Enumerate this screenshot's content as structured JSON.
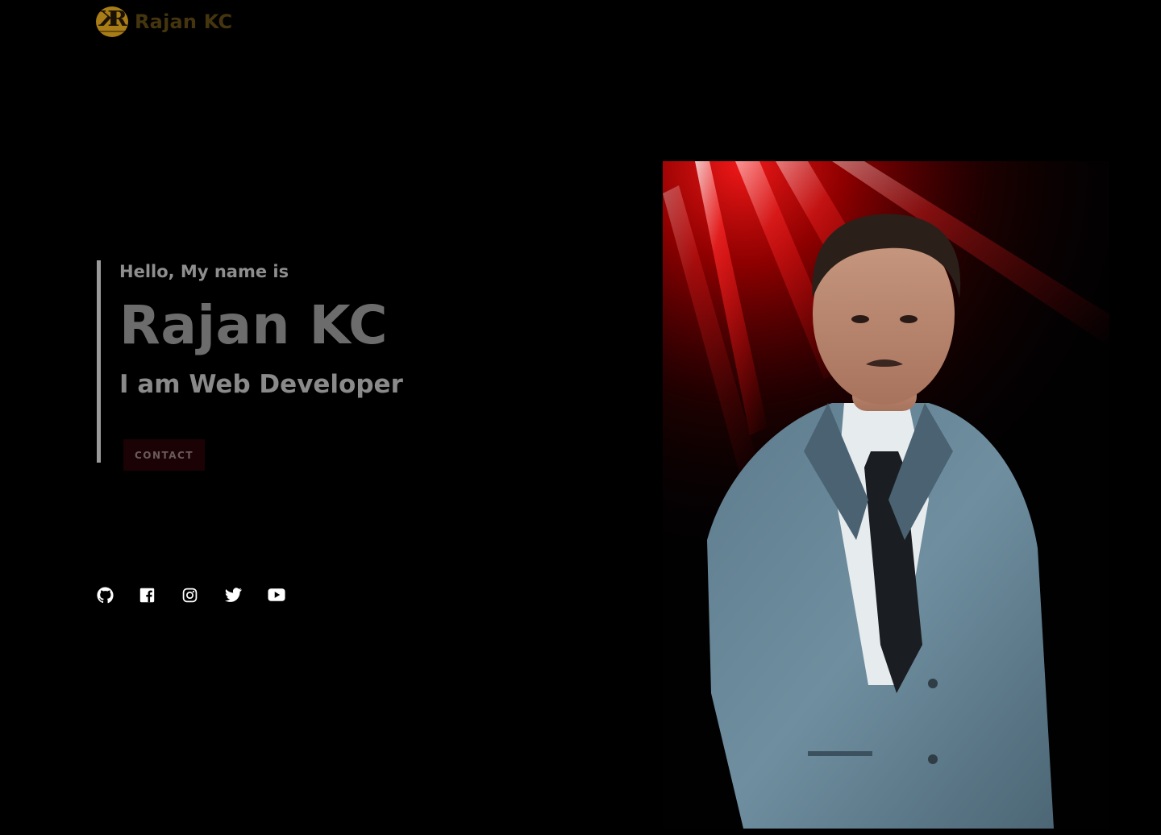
{
  "header": {
    "logo_text": "Rajan KC",
    "logo_mark": "KR monogram",
    "logo_color": "#a87c16"
  },
  "hero": {
    "greeting": "Hello, My name is",
    "name": "Rajan KC",
    "role": "I am Web Developer",
    "cta_label": "CONTACT"
  },
  "socials": [
    {
      "icon": "github-icon",
      "name": "GitHub"
    },
    {
      "icon": "facebook-icon",
      "name": "Facebook"
    },
    {
      "icon": "instagram-icon",
      "name": "Instagram"
    },
    {
      "icon": "twitter-icon",
      "name": "Twitter"
    },
    {
      "icon": "youtube-icon",
      "name": "YouTube"
    }
  ],
  "portrait": {
    "subject": "portrait photo of a man in a grey suit",
    "accent": "#c8090d"
  },
  "colors": {
    "background": "#000000",
    "text_muted": "#8e8e8e",
    "button_bg": "#1a0205"
  }
}
